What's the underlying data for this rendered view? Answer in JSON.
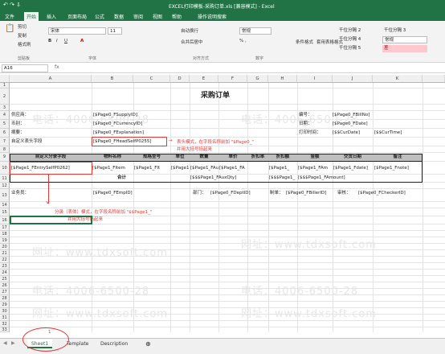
{
  "window": {
    "title": "EXCEL打印模板-采购订单.xls [兼容模式] - Excel",
    "quick_access": "↶ ↷ ⇩"
  },
  "menu": {
    "tabs": [
      "文件",
      "开始",
      "插入",
      "页面布局",
      "公式",
      "数据",
      "审阅",
      "视图",
      "帮助",
      "操作说明搜索"
    ]
  },
  "ribbon": {
    "cut": "剪切",
    "copy": "复制",
    "format_painter": "格式刷",
    "font_name": "宋体",
    "font_size": "11",
    "wrap_text": "自动换行",
    "merge_center": "合并后居中",
    "number_format": "常规",
    "conditional_format": "条件格式",
    "table_format": "套用表格格式",
    "styles": [
      "千位分隔 2",
      "千位分隔 3",
      "千位分隔 4",
      "千位分隔 5",
      "常规",
      "差"
    ],
    "groups": [
      "剪贴板",
      "字体",
      "对齐方式",
      "数字"
    ]
  },
  "formula_bar": {
    "name_box": "A16",
    "fx": "fx"
  },
  "columns": [
    "A",
    "B",
    "C",
    "D",
    "E",
    "F",
    "G",
    "H",
    "I",
    "J",
    "K"
  ],
  "rows": [
    "1",
    "2",
    "3",
    "4",
    "5",
    "6",
    "7",
    "8",
    "9",
    "10",
    "11",
    "12",
    "13",
    "14",
    "15",
    "16",
    "17",
    "18",
    "19",
    "20",
    "21",
    "22",
    "23",
    "24",
    "25",
    "26",
    "27",
    "28",
    "29",
    "30",
    "31",
    "32",
    "33"
  ],
  "sheet": {
    "title": "采购订单",
    "supplier_label": "供应商：",
    "supplier_value": "[$Page0_FSupplyID]",
    "currency_label": "币别：",
    "currency_value": "[$Page0_FCurrencyID]",
    "summary_label": "摘要：",
    "summary_value": "[$Page0_FExplanation]",
    "custom_header_label": "自定义表头字段",
    "custom_header_value": "[$Page0_FHeadSelfP0255]",
    "billno_label": "编号：",
    "billno_value": "[$Page0_FBillNo]",
    "date_label": "日期：",
    "date_value": "[$Page0_FDate]",
    "print_time_label": "打印时间：",
    "print_time_value1": "[$$CurDate]",
    "print_time_value2": "[$$CurTime]",
    "table_headers": [
      "自定义分录字段",
      "物料名称",
      "规格型号",
      "单位",
      "数量",
      "单价",
      "折扣率",
      "折扣额",
      "金额",
      "交货日期",
      "备注"
    ],
    "entry_row": [
      "[$Page1_FEntrySelfP0262]",
      "[$Page1_FItem",
      "[$Page1_FIt",
      "[$Page1",
      "[$Page1_FAu",
      "[$Page1_FA",
      "",
      "[$Page1_",
      "[$Page1_FAm",
      "[$Page1_Fdate]",
      "[$Page1_Fnote]"
    ],
    "total_label": "合计",
    "total_qty": "[$$$Page1_FAuxQty]",
    "total_amount": "[$$$Page1_FAmount]",
    "total_discount": "[$$$Page1_",
    "salesman_label": "业务员：",
    "salesman_value": "[$Page0_FEmpID]",
    "dept_label": "部门：",
    "dept_value": "[$Page0_FDeptID]",
    "maker_label": "制单：",
    "maker_value": "[$Page0_FBillerID]",
    "checker_label": "审核：",
    "checker_value": "[$Page0_FCheckerID]"
  },
  "annotations": {
    "header_mode_line1": "表头模式，在字段名称前加 \"$Page0_\"",
    "header_mode_line2": "并用大括号括起来",
    "entry_mode_line1": "分录（表体）模式，在字段名称前加 \"$$Page1_\"",
    "entry_mode_line2": "并用大括号括起来",
    "sheet_number": "1"
  },
  "watermarks": [
    "电话：4006-6500-28",
    "网址：www.tdxsoft.com",
    "电话：4006-6500-28",
    "网址：www.tdxsoft.com",
    "电话：4006-6500-28",
    "网址：www.tdxsoft.com"
  ],
  "sheet_tabs": [
    "Sheet1",
    "Template",
    "Description"
  ],
  "add_sheet": "⊕"
}
